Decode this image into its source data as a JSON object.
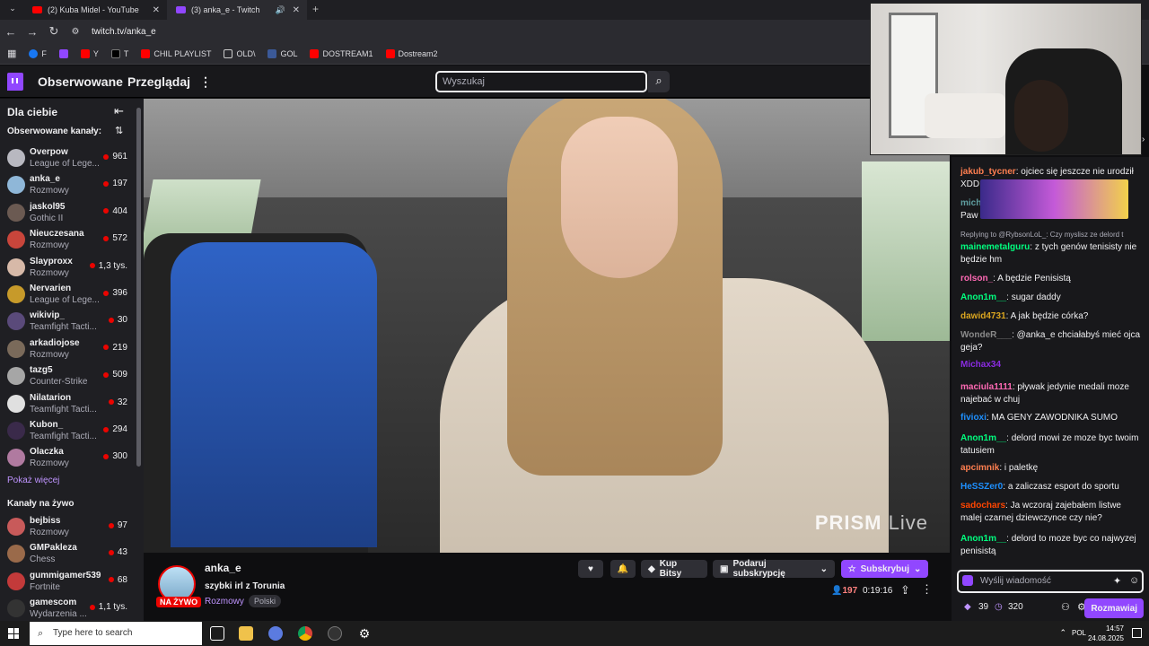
{
  "browser": {
    "tabs": [
      {
        "title": "(2) Kuba Midel - YouTube",
        "active": false
      },
      {
        "title": "(3) anka_e - Twitch",
        "active": true
      }
    ],
    "url": "twitch.tv/anka_e",
    "bookmarks": [
      "F",
      "Y",
      "T",
      "CHIL PLAYLIST",
      "OLD\\",
      "GOL",
      "DOSTREAM1",
      "Dostream2"
    ]
  },
  "header": {
    "followed": "Obserwowane",
    "browse": "Przeglądaj",
    "search_placeholder": "Wyszukaj"
  },
  "sidebar": {
    "title": "Dla ciebie",
    "followed_title": "Obserwowane kanały:",
    "followed": [
      {
        "name": "Overpow",
        "game": "League of Lege...",
        "viewers": "961"
      },
      {
        "name": "anka_e",
        "game": "Rozmowy",
        "viewers": "197"
      },
      {
        "name": "jaskol95",
        "game": "Gothic II",
        "viewers": "404"
      },
      {
        "name": "Nieuczesana",
        "game": "Rozmowy",
        "viewers": "572"
      },
      {
        "name": "Slayproxx",
        "game": "Rozmowy",
        "viewers": "1,3 tys."
      },
      {
        "name": "Nervarien",
        "game": "League of Lege...",
        "viewers": "396"
      },
      {
        "name": "wikivip_",
        "game": "Teamfight Tacti...",
        "viewers": "30"
      },
      {
        "name": "arkadiojose",
        "game": "Rozmowy",
        "viewers": "219"
      },
      {
        "name": "tazg5",
        "game": "Counter-Strike",
        "viewers": "509"
      },
      {
        "name": "Nilatarion",
        "game": "Teamfight Tacti...",
        "viewers": "32"
      },
      {
        "name": "Kubon_",
        "game": "Teamfight Tacti...",
        "viewers": "294"
      },
      {
        "name": "Olaczka",
        "game": "Rozmowy",
        "viewers": "300"
      }
    ],
    "show_more": "Pokaż więcej",
    "live_title": "Kanały na żywo",
    "live": [
      {
        "name": "bejbiss",
        "game": "Rozmowy",
        "viewers": "97"
      },
      {
        "name": "GMPakleza",
        "game": "Chess",
        "viewers": "43"
      },
      {
        "name": "gummigamer539",
        "game": "Fortnite",
        "viewers": "68"
      },
      {
        "name": "gamescom",
        "game": "Wydarzenia ...",
        "viewers": "1,1 tys."
      }
    ]
  },
  "video": {
    "watermark_a": "PRISM",
    "watermark_b": "Live"
  },
  "stream": {
    "channel": "anka_e",
    "live_badge": "NA ŻYWO",
    "title": "szybki irl z Torunia",
    "category": "Rozmowy",
    "tag": "Polski",
    "buttons": {
      "bits": "Kup Bitsy",
      "gift": "Podaruj subskrypcję",
      "subscribe": "Subskrybuj"
    },
    "viewers": "197",
    "uptime": "0:19:16"
  },
  "chat": {
    "messages": [
      {
        "user": "jakub_tycner",
        "text": "ojciec się jeszcze nie urodził",
        "color": "#ff7f50"
      },
      {
        "user": "",
        "text": "XDD",
        "color": "#efeff1"
      },
      {
        "user": "mich",
        "text": "",
        "color": "#5f9ea0"
      },
      {
        "user": "",
        "text": "Paw",
        "color": "#efeff1"
      },
      {
        "user": "",
        "text": "Replying to @RybsonLoL_: Czy myslisz ze delord t",
        "color": "#adadb8"
      },
      {
        "user": "mainemetalguru",
        "text": "z tych genów tenisisty nie będzie hm",
        "color": "#00ff7f"
      },
      {
        "user": "rolson_",
        "text": "A będzie Penisistą",
        "color": "#ff69b4"
      },
      {
        "user": "Anon1m__",
        "text": "sugar daddy",
        "color": "#00ff7f"
      },
      {
        "user": "dawid4731",
        "text": "A jak będzie córka?",
        "color": "#daa520"
      },
      {
        "user": "WondeR___",
        "text": "@anka_e chciałabyś mieć ojca geja?",
        "color": "#8a8a8a"
      },
      {
        "user": "Michax34",
        "text": "",
        "color": "#8a2be2"
      },
      {
        "user": "maciula1111",
        "text": "pływak jedynie medali moze najebać w chuj",
        "color": "#ff69b4"
      },
      {
        "user": "fivioxi",
        "text": "MA GENY ZAWODNIKA SUMO",
        "color": "#1e90ff"
      },
      {
        "user": "Anon1m__",
        "text": "delord mowi ze moze byc twoim tatusiem",
        "color": "#00ff7f"
      },
      {
        "user": "apcimnik",
        "text": "i paletkę",
        "color": "#ff7f50"
      },
      {
        "user": "HeSSZer0",
        "text": "a zaliczasz esport do sportu",
        "color": "#1e90ff"
      },
      {
        "user": "sadochars",
        "text": "Ja wczoraj zajebałem listwe malej czarnej dziewczynce   czy nie?",
        "color": "#ff4500"
      },
      {
        "user": "Anon1m__",
        "text": "delord to moze byc co najwyzej penisistą",
        "color": "#00ff7f"
      }
    ],
    "input_placeholder": "Wyślij wiadomość",
    "points_a": "39",
    "points_b": "320",
    "send": "Rozmawiaj"
  },
  "taskbar": {
    "search": "Type here to search",
    "lang": "POL",
    "time": "14:57",
    "date": "24.08.2025"
  },
  "colors": {
    "accent": "#9147ff",
    "live": "#eb0400"
  }
}
